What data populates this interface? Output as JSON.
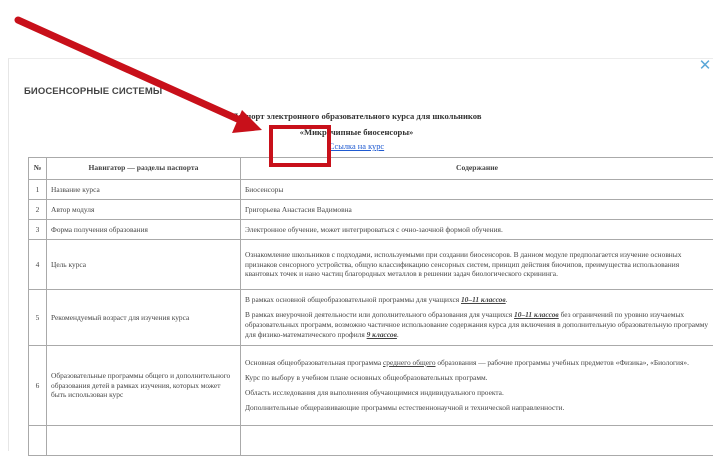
{
  "modal": {
    "title": "БИОСЕНСОРНЫЕ СИСТЕМЫ",
    "close_icon": "close-icon",
    "close_glyph": "✕"
  },
  "document": {
    "heading_line1": "Паспорт электронного образовательного курса для школьников",
    "heading_line2": "«Микрочипные биосенсоры»",
    "link_text": "Ссылка на курс"
  },
  "table": {
    "headers": [
      "№",
      "Навигатор — разделы паспорта",
      "Содержание"
    ],
    "rows": [
      {
        "num": "1",
        "section": "Название курса",
        "content": [
          "Биосенсоры"
        ]
      },
      {
        "num": "2",
        "section": "Автор модуля",
        "content": [
          "Григорьева Анастасия Вадимовна"
        ]
      },
      {
        "num": "3",
        "section": "Форма получения образования",
        "content": [
          "Электронное обучение, может интегрироваться с очно-заочной формой обучения."
        ]
      },
      {
        "num": "4",
        "section": "Цель курса",
        "content": [
          "Ознакомление школьников с подходами, используемыми при создании биосенсоров. В данном модуле предполагается изучение основных признаков сенсорного устройства, общую классификацию сенсорных систем, принцип действия биочипов, преимущества использования квантовых точек и нано частиц благородных металлов в решении задач биологического скрининга."
        ]
      },
      {
        "num": "5",
        "section": "Рекомендуемый возраст для изучения курса",
        "content_a": "В рамках основной общеобразовательной программы для учащихся ",
        "content_a_em": "10–11 классов",
        "content_b1": "В рамках внеурочной деятельности или дополнительного образования для учащихся ",
        "content_b1_em": "10–11 классов",
        "content_b2": " без ограничений по уровню изучаемых образовательных программ, возможно частичное использование содержания курса для включения в дополнительную образовательную программу для физико-математического профиля ",
        "content_b2_em": "9 классов"
      },
      {
        "num": "6",
        "section": "Образовательные программы общего и дополнительного образования детей в рамках изучения, которых может быть использован курс",
        "content_a1": "Основная общеобразовательная программа ",
        "content_a_u": "среднего общего",
        "content_a2": " образования — рабочие программы учебных предметов «Физика», «Биология».",
        "content_b": "Курс по выбору в учебном плане основных общеобразовательных программ.",
        "content_c": "Область исследования для выполнения обучающимися индивидуального проекта.",
        "content_d": "Дополнительные общеразвивающие программы естественнонаучной и технической направленности."
      }
    ]
  },
  "annotation": {
    "arrow_color": "#c8101a",
    "box_color": "#c8101a"
  }
}
